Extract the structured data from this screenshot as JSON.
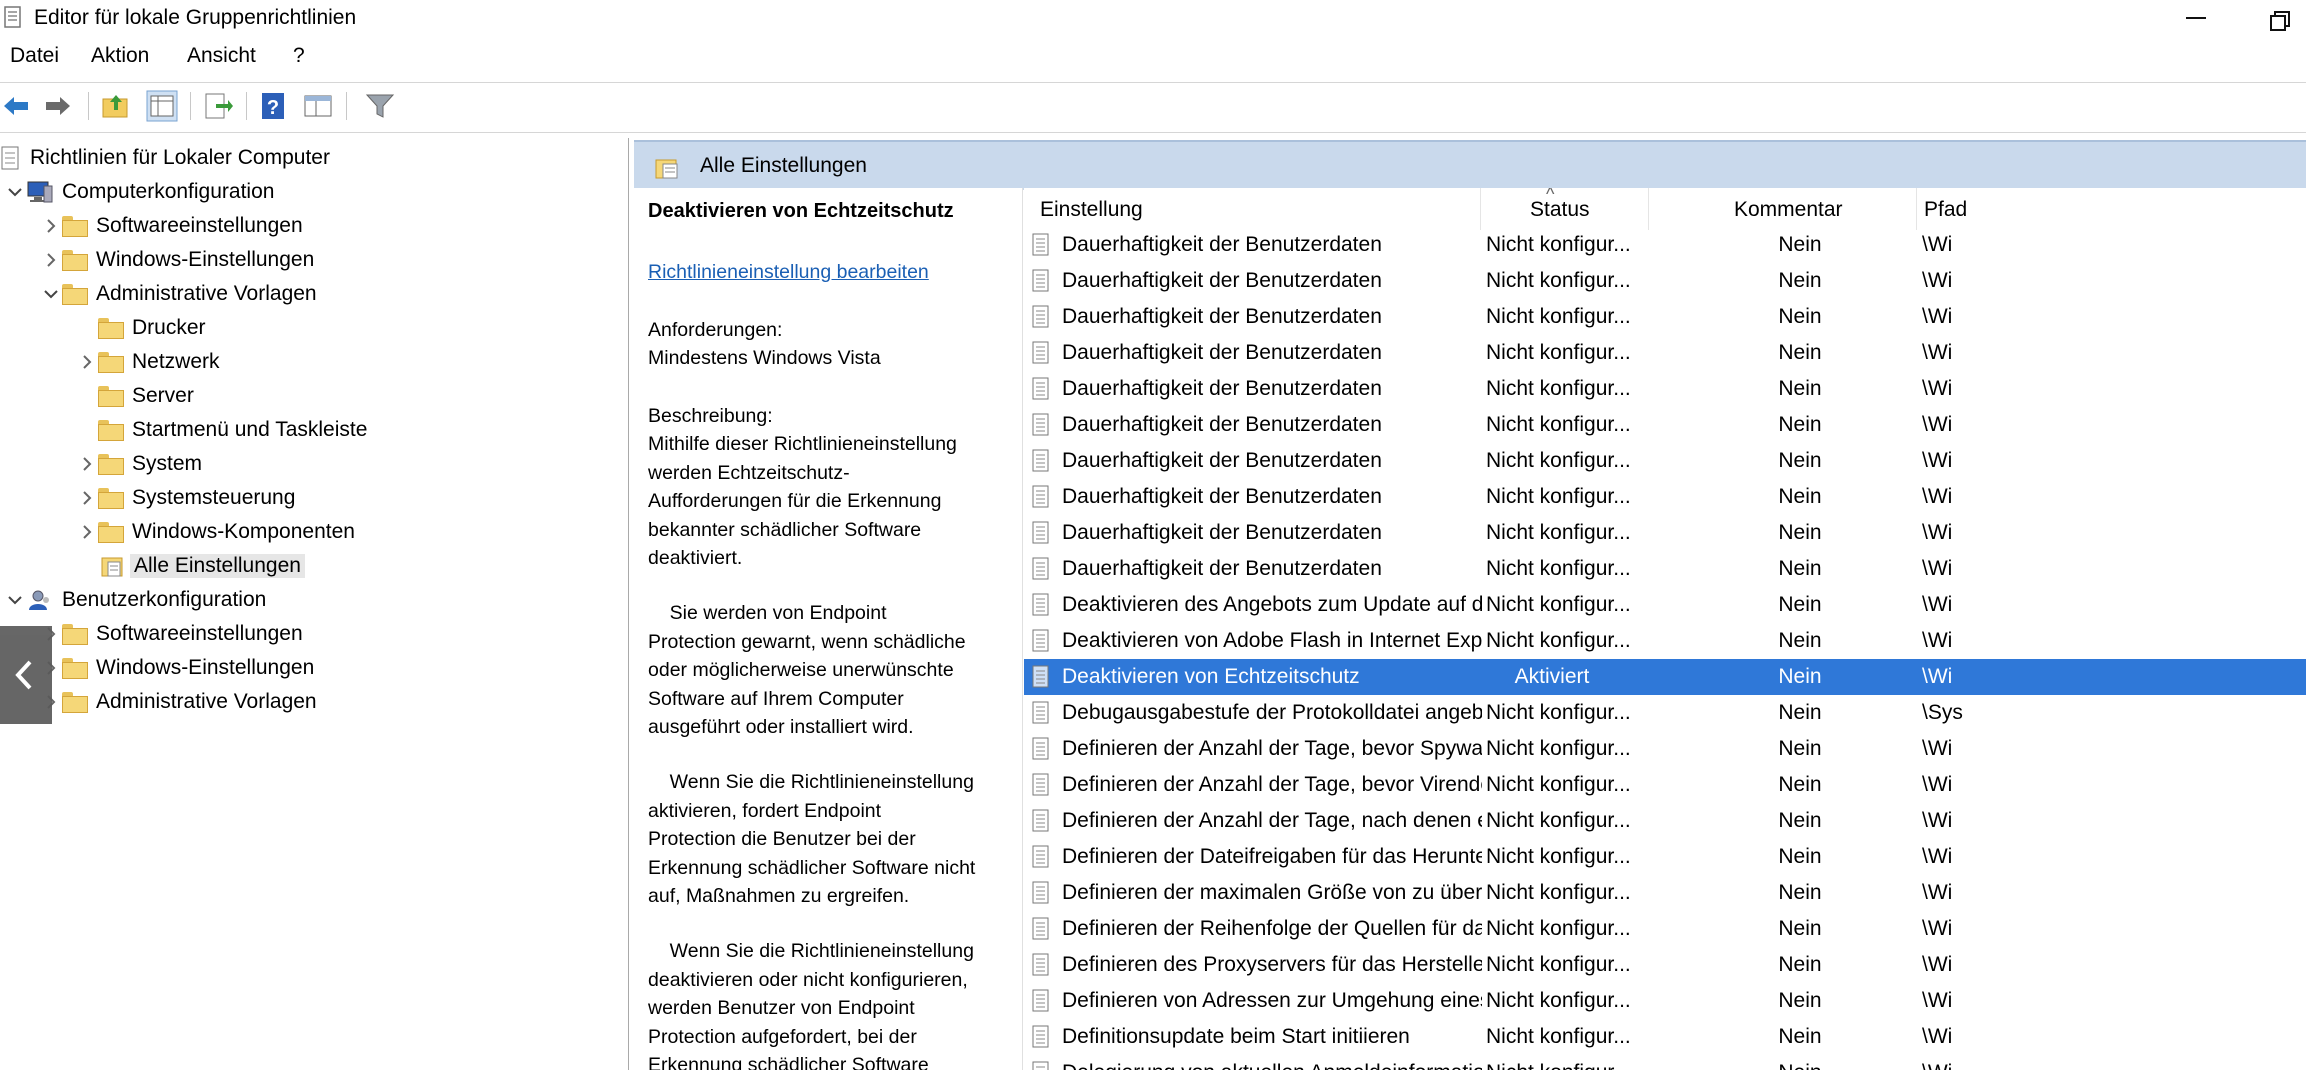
{
  "window": {
    "title": "Editor für lokale Gruppenrichtlinien"
  },
  "menu": {
    "items": [
      "Datei",
      "Aktion",
      "Ansicht",
      "?"
    ]
  },
  "toolbar": {
    "buttons": [
      "back-arrow-icon",
      "forward-arrow-icon",
      "up-folder-icon",
      "show-hide-tree-icon",
      "export-list-icon",
      "help-icon",
      "properties-pane-icon",
      "filter-icon"
    ]
  },
  "tree": {
    "root": "Richtlinien für Lokaler Computer",
    "computer": "Computerkonfiguration",
    "c_software": "Softwareeinstellungen",
    "c_windows": "Windows-Einstellungen",
    "c_admin": "Administrative Vorlagen",
    "drucker": "Drucker",
    "netzwerk": "Netzwerk",
    "server": "Server",
    "startmenu": "Startmenü und Taskleiste",
    "system": "System",
    "systemsteuerung": "Systemsteuerung",
    "windows_komponenten": "Windows-Komponenten",
    "alle": "Alle Einstellungen",
    "user": "Benutzerkonfiguration",
    "u_software": "Softwareeinstellungen",
    "u_windows": "Windows-Einstellungen",
    "u_admin": "Administrative Vorlagen"
  },
  "right_header": {
    "title": "Alle Einstellungen"
  },
  "description": {
    "title": "Deaktivieren von Echtzeitschutz",
    "edit_link": "Richtlinieneinstellung bearbeiten",
    "requirements_label": "Anforderungen:",
    "requirements_value": "Mindestens Windows Vista",
    "description_label": "Beschreibung:",
    "p1": "Mithilfe dieser Richtlinieneinstellung\nwerden Echtzeitschutz-\nAufforderungen für die Erkennung\nbekannter schädlicher Software\ndeaktiviert.",
    "p2": "    Sie werden von Endpoint\nProtection gewarnt, wenn schädliche\noder möglicherweise unerwünschte\nSoftware auf Ihrem Computer\nausgeführt oder installiert wird.",
    "p3": "    Wenn Sie die Richtlinieneinstellung\naktivieren, fordert Endpoint\nProtection die Benutzer bei der\nErkennung schädlicher Software nicht\nauf, Maßnahmen zu ergreifen.",
    "p4": "    Wenn Sie die Richtlinieneinstellung\ndeaktivieren oder nicht konfigurieren,\nwerden Benutzer von Endpoint\nProtection aufgefordert, bei der\nErkennung schädlicher Software"
  },
  "list": {
    "columns": {
      "name": "Einstellung",
      "status": "Status",
      "comment": "Kommentar",
      "path": "Pfad"
    },
    "rows": [
      {
        "name": "Dauerhaftigkeit der Benutzerdaten",
        "status": "Nicht konfigur...",
        "comment": "Nein",
        "path": "\\Wi"
      },
      {
        "name": "Dauerhaftigkeit der Benutzerdaten",
        "status": "Nicht konfigur...",
        "comment": "Nein",
        "path": "\\Wi"
      },
      {
        "name": "Dauerhaftigkeit der Benutzerdaten",
        "status": "Nicht konfigur...",
        "comment": "Nein",
        "path": "\\Wi"
      },
      {
        "name": "Dauerhaftigkeit der Benutzerdaten",
        "status": "Nicht konfigur...",
        "comment": "Nein",
        "path": "\\Wi"
      },
      {
        "name": "Dauerhaftigkeit der Benutzerdaten",
        "status": "Nicht konfigur...",
        "comment": "Nein",
        "path": "\\Wi"
      },
      {
        "name": "Dauerhaftigkeit der Benutzerdaten",
        "status": "Nicht konfigur...",
        "comment": "Nein",
        "path": "\\Wi"
      },
      {
        "name": "Dauerhaftigkeit der Benutzerdaten",
        "status": "Nicht konfigur...",
        "comment": "Nein",
        "path": "\\Wi"
      },
      {
        "name": "Dauerhaftigkeit der Benutzerdaten",
        "status": "Nicht konfigur...",
        "comment": "Nein",
        "path": "\\Wi"
      },
      {
        "name": "Dauerhaftigkeit der Benutzerdaten",
        "status": "Nicht konfigur...",
        "comment": "Nein",
        "path": "\\Wi"
      },
      {
        "name": "Dauerhaftigkeit der Benutzerdaten",
        "status": "Nicht konfigur...",
        "comment": "Nein",
        "path": "\\Wi"
      },
      {
        "name": "Deaktivieren des Angebots zum Update auf die aktuelle Versi...",
        "status": "Nicht konfigur...",
        "comment": "Nein",
        "path": "\\Wi"
      },
      {
        "name": "Deaktivieren von Adobe Flash in Internet Explorer und Verhi...",
        "status": "Nicht konfigur...",
        "comment": "Nein",
        "path": "\\Wi"
      },
      {
        "name": "Deaktivieren von Echtzeitschutz",
        "status": "Aktiviert",
        "comment": "Nein",
        "path": "\\Wi",
        "selected": true
      },
      {
        "name": "Debugausgabestufe der Protokolldatei angeben",
        "status": "Nicht konfigur...",
        "comment": "Nein",
        "path": "\\Sys"
      },
      {
        "name": "Definieren der Anzahl der Tage, bevor Spywaredefinitionen a...",
        "status": "Nicht konfigur...",
        "comment": "Nein",
        "path": "\\Wi"
      },
      {
        "name": "Definieren der Anzahl der Tage, bevor Virendefinitionen als v...",
        "status": "Nicht konfigur...",
        "comment": "Nein",
        "path": "\\Wi"
      },
      {
        "name": "Definieren der Anzahl der Tage, nach denen ein Nachholdefi...",
        "status": "Nicht konfigur...",
        "comment": "Nein",
        "path": "\\Wi"
      },
      {
        "name": "Definieren der Dateifreigaben für das Herunterladen von Def...",
        "status": "Nicht konfigur...",
        "comment": "Nein",
        "path": "\\Wi"
      },
      {
        "name": "Definieren der maximalen Größe von zu überprüfenden heru...",
        "status": "Nicht konfigur...",
        "comment": "Nein",
        "path": "\\Wi"
      },
      {
        "name": "Definieren der Reihenfolge der Quellen für das Herunterlade...",
        "status": "Nicht konfigur...",
        "comment": "Nein",
        "path": "\\Wi"
      },
      {
        "name": "Definieren des Proxyservers für das Herstellen einer Verbindu...",
        "status": "Nicht konfigur...",
        "comment": "Nein",
        "path": "\\Wi"
      },
      {
        "name": "Definieren von Adressen zur Umgehung eines Proxyservers",
        "status": "Nicht konfigur...",
        "comment": "Nein",
        "path": "\\Wi"
      },
      {
        "name": "Definitionsupdate beim Start initiieren",
        "status": "Nicht konfigur...",
        "comment": "Nein",
        "path": "\\Wi"
      },
      {
        "name": "Delegierung von aktuellen Anmeldeinformationen mit reine...",
        "status": "Nicht konfigur...",
        "comment": "Nein",
        "path": "\\Wi"
      }
    ]
  },
  "colors": {
    "selection": "#2f78d8",
    "header_band": "#c9d9ec",
    "link": "#1a5fb4"
  }
}
